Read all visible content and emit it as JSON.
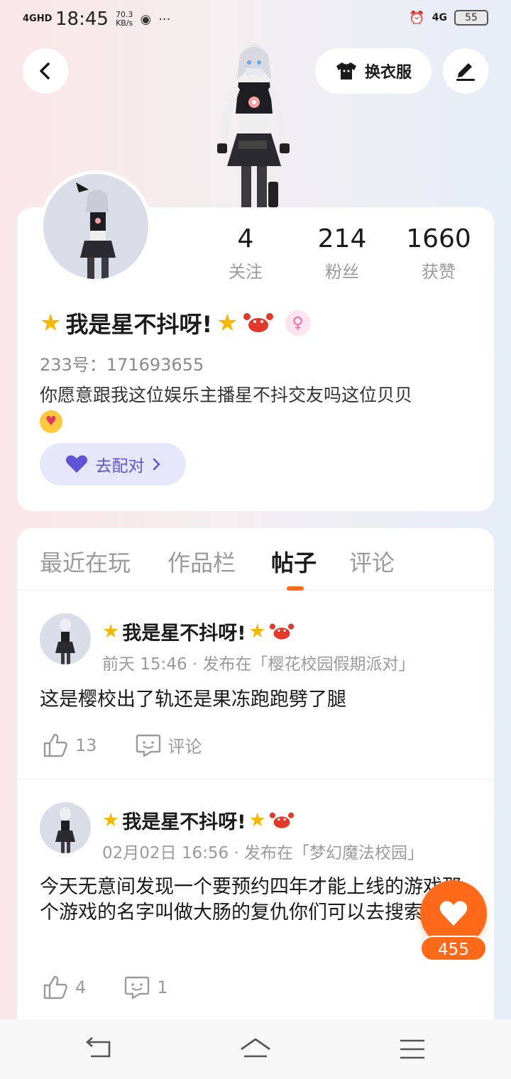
{
  "status_bar": {
    "network": "4GHD",
    "time": "18:45",
    "speed_value": "70.3",
    "speed_unit": "KB/s",
    "more": "···",
    "network_right": "4G",
    "battery": "55"
  },
  "header": {
    "outfit_label": "换衣服"
  },
  "profile": {
    "stats": [
      {
        "value": "4",
        "label": "关注"
      },
      {
        "value": "214",
        "label": "粉丝"
      },
      {
        "value": "1660",
        "label": "获赞"
      }
    ],
    "name": "我是星不抖呀!",
    "uid": "233号：171693655",
    "bio": "你愿意跟我这位娱乐主播星不抖交友吗这位贝贝",
    "match_label": "去配对"
  },
  "tabs": [
    "最近在玩",
    "作品栏",
    "帖子",
    "评论"
  ],
  "active_tab": "帖子",
  "posts": [
    {
      "author": "我是星不抖呀!",
      "meta": "前天 15:46 · 发布在「樱花校园假期派对」",
      "text": "这是樱校出了轨还是果冻跑跑劈了腿",
      "likes": "13",
      "comments": "评论"
    },
    {
      "author": "我是星不抖呀!",
      "meta": "02月02日 16:56 · 发布在「梦幻魔法校园」",
      "text": "今天无意间发现一个要预约四年才能上线的游戏那个游戏的名字叫做大肠的复仇你们可以去搜索一下",
      "likes": "4",
      "comments": "1"
    }
  ],
  "floating_like_count": "455",
  "icons": {
    "back": "back-arrow-icon",
    "outfit": "tshirt-icon",
    "edit": "pen-icon",
    "star": "star-emoji",
    "crab": "crab-emoji",
    "gender": "female-icon",
    "heart": "heart-icon",
    "like": "thumbs-up-icon",
    "comment": "comment-icon"
  },
  "colors": {
    "accent": "#ff6a1a",
    "match_bg": "#e7e7fb",
    "match_text": "#5f54d6",
    "female": "#f06a9a"
  }
}
